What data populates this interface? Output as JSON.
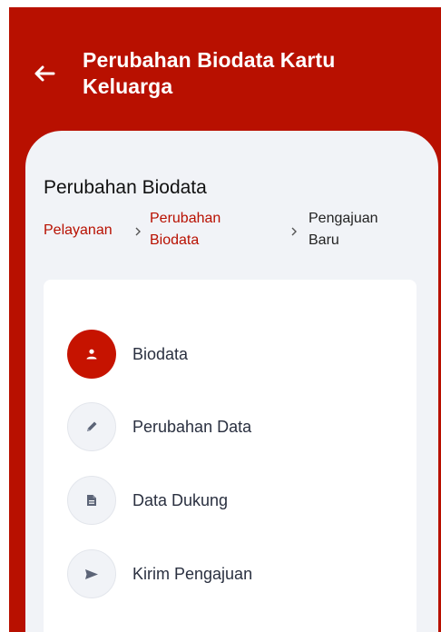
{
  "header": {
    "title": "Perubahan Biodata Kartu Keluarga",
    "back_icon": "arrow-left-icon"
  },
  "panel": {
    "title": "Perubahan Biodata",
    "breadcrumb": {
      "item1": "Pelayanan",
      "item2_line1": "Perubahan",
      "item2_line2": "Biodata",
      "item3_line1": "Pengajuan",
      "item3_line2": "Baru",
      "separator_icon": "chevron-right-icon"
    }
  },
  "steps": [
    {
      "label": "Biodata",
      "icon": "user-icon",
      "active": true
    },
    {
      "label": "Perubahan Data",
      "icon": "pencil-icon",
      "active": false
    },
    {
      "label": "Data Dukung",
      "icon": "document-icon",
      "active": false
    },
    {
      "label": "Kirim Pengajuan",
      "icon": "send-icon",
      "active": false
    }
  ],
  "colors": {
    "brand_red": "#b81000",
    "active_step": "#c61300",
    "panel_bg": "#f1f3f7",
    "card_bg": "#ffffff"
  }
}
